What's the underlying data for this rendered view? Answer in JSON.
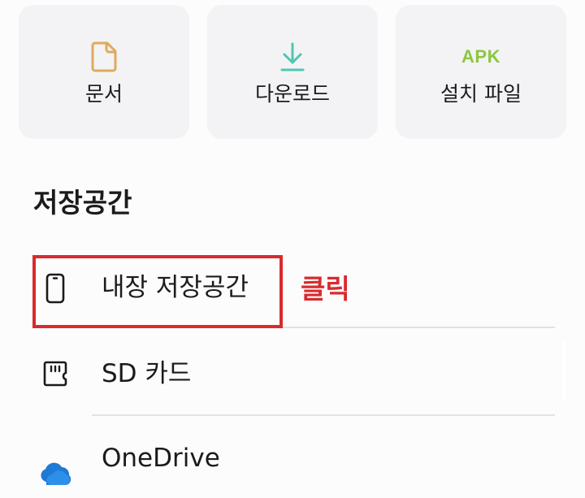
{
  "categories": [
    {
      "label": "문서",
      "icon": "document-icon",
      "color": "#e0a95b"
    },
    {
      "label": "다운로드",
      "icon": "download-icon",
      "color": "#4cc7b4"
    },
    {
      "label": "설치 파일",
      "icon": "apk-icon",
      "icon_text": "APK",
      "color": "#8dc63f"
    }
  ],
  "storage": {
    "title": "저장공간",
    "items": [
      {
        "label": "내장 저장공간",
        "icon": "phone-icon"
      },
      {
        "label": "SD 카드",
        "icon": "sd-card-icon"
      },
      {
        "label": "OneDrive",
        "icon": "onedrive-icon",
        "color": "#1f7ad6"
      }
    ]
  },
  "annotation": {
    "text": "클릭",
    "color": "#d82b2f"
  }
}
